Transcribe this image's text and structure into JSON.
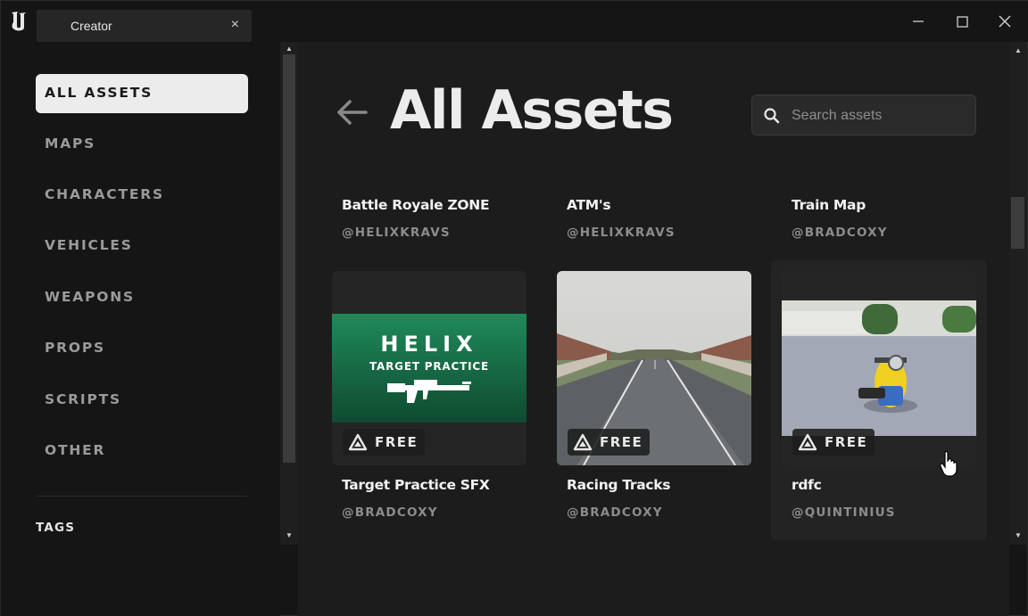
{
  "window": {
    "tab_label": "Creator",
    "tab_close": "×"
  },
  "sidebar": {
    "items": [
      {
        "label": "ALL ASSETS",
        "active": true
      },
      {
        "label": "MAPS",
        "active": false
      },
      {
        "label": "CHARACTERS",
        "active": false
      },
      {
        "label": "VEHICLES",
        "active": false
      },
      {
        "label": "WEAPONS",
        "active": false
      },
      {
        "label": "PROPS",
        "active": false
      },
      {
        "label": "SCRIPTS",
        "active": false
      },
      {
        "label": "OTHER",
        "active": false
      }
    ],
    "tags_label": "TAGS"
  },
  "main": {
    "title": "All Assets",
    "search": {
      "placeholder": "Search assets",
      "value": ""
    },
    "top_row": [
      {
        "title": "Battle Royale ZONE",
        "author": "@HELIXKRAVS"
      },
      {
        "title": "ATM's",
        "author": "@HELIXKRAVS"
      },
      {
        "title": "Train Map",
        "author": "@BRADCOXY"
      }
    ],
    "cards": [
      {
        "title": "Target Practice SFX",
        "author": "@BRADCOXY",
        "badge": "FREE",
        "thumb_title": "HELIX",
        "thumb_subtitle": "TARGET PRACTICE"
      },
      {
        "title": "Racing Tracks",
        "author": "@BRADCOXY",
        "badge": "FREE"
      },
      {
        "title": "rdfc",
        "author": "@QUINTINIUS",
        "badge": "FREE"
      }
    ]
  },
  "colors": {
    "background": "#1c1c1c",
    "sidebar_active": "#ececec",
    "helix_green": "#1f8a5a"
  }
}
